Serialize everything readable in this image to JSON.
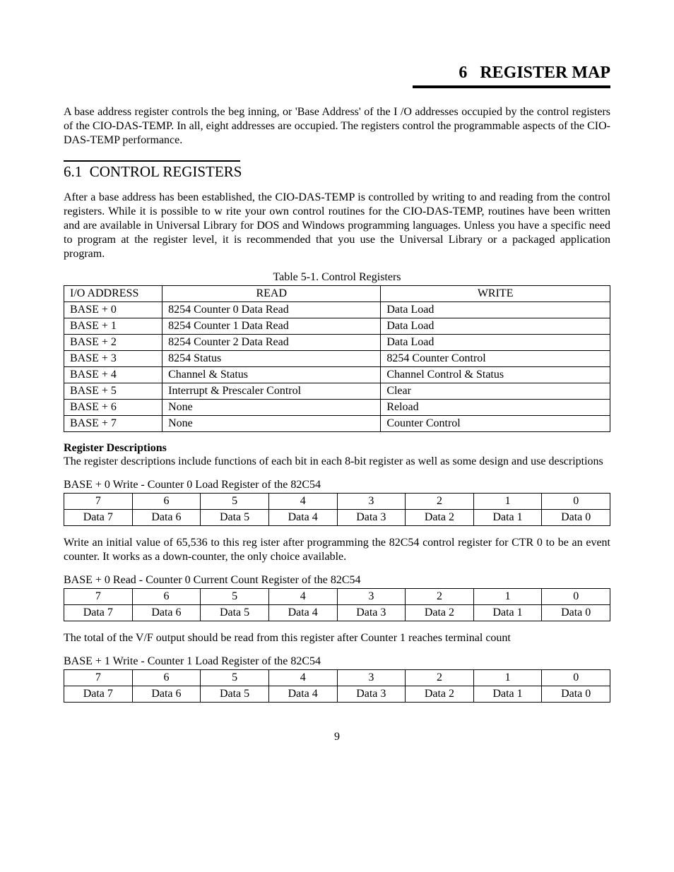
{
  "chapter": {
    "number": "6",
    "title": "REGISTER MAP"
  },
  "intro_paragraph": "A base address register controls the beg inning, or 'Base Address' of the I /O addresses occupied by the control registers of the CIO-DAS-TEMP.  In all, eight addresses are occupied.  The registers control the programmable aspects of the CIO-DAS-TEMP performance.",
  "section": {
    "number": "6.1",
    "title": "CONTROL REGISTERS"
  },
  "section_paragraph": "After a base address has been established, the CIO-DAS-TEMP is controlled by writing to and reading from the control registers.  While it is possible to w rite your own control routines for the CIO-DAS-TEMP, routines have been written and are available in Universal Library for DOS and Windows programming languages.  Unless you have a specific need to program at the register level, it is recommended that you use the Universal Library or a packaged application program.",
  "table5_1": {
    "caption": "Table 5-1. Control Registers",
    "headers": {
      "addr": "I/O ADDRESS",
      "read": "READ",
      "write": "WRITE"
    },
    "rows": [
      {
        "addr": "BASE + 0",
        "read": "8254 Counter 0 Data Read",
        "write": "Data Load"
      },
      {
        "addr": "BASE + 1",
        "read": "8254 Counter 1 Data Read",
        "write": "Data Load"
      },
      {
        "addr": "BASE + 2",
        "read": "8254 Counter 2 Data Read",
        "write": "Data Load"
      },
      {
        "addr": "BASE + 3",
        "read": "8254 Status",
        "write": "8254 Counter Control"
      },
      {
        "addr": "BASE + 4",
        "read": "Channel & Status",
        "write": "Channel Control & Status"
      },
      {
        "addr": "BASE + 5",
        "read": "Interrupt & Prescaler Control",
        "write": "Clear"
      },
      {
        "addr": "BASE + 6",
        "read": "None",
        "write": "Reload"
      },
      {
        "addr": "BASE + 7",
        "read": "None",
        "write": "Counter Control"
      }
    ]
  },
  "reg_desc": {
    "heading": "Register Descriptions",
    "text": "The register descriptions include functions of each bit in each 8-bit register as well as some design and use descriptions"
  },
  "bit_header": [
    "7",
    "6",
    "5",
    "4",
    "3",
    "2",
    "1",
    "0"
  ],
  "bit_data": [
    "Data 7",
    "Data 6",
    "Data 5",
    "Data 4",
    "Data 3",
    "Data 2",
    "Data 1",
    "Data 0"
  ],
  "base0_write": {
    "label": "BASE + 0    Write  -  Counter 0 Load Register of the 82C54",
    "note": "Write an initial value of 65,536 to this reg ister after programming the 82C54 control register for CTR 0 to be an event counter.  It works as a down-counter, the only choice available."
  },
  "base0_read": {
    "label": "BASE + 0    Read  -  Counter 0 Current Count Register of the 82C54",
    "note": "The total of the V/F output should be read from this register after Counter 1 reaches terminal count"
  },
  "base1_write": {
    "label": "BASE + 1    Write  -  Counter 1 Load Register of the 82C54"
  },
  "page_number": "9"
}
